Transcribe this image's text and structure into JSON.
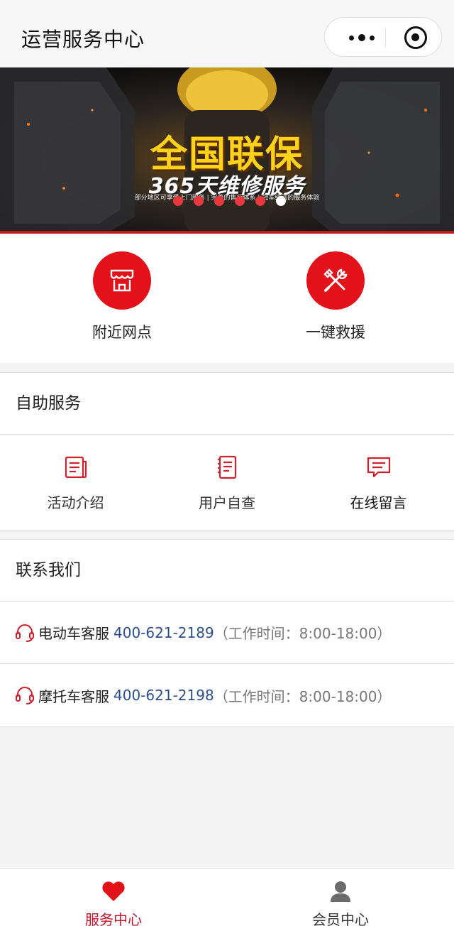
{
  "navbar": {
    "title": "运营服务中心",
    "more_icon": "more-dots-icon",
    "close_icon": "target-icon"
  },
  "banner": {
    "headline": "全国联保",
    "subline": "365天维修服务",
    "tagline": "部分地区可享受上门服务 | 完善的售后体系 | 冠军级别的服务体验",
    "slide_count": 6,
    "active_slide": 6,
    "colors": {
      "headline": "#ffd21a",
      "accent": "#c21818",
      "dot": "#e8383d"
    }
  },
  "quick_actions": [
    {
      "label": "附近网点",
      "icon": "store-icon"
    },
    {
      "label": "一键救援",
      "icon": "tools-icon"
    }
  ],
  "self_service": {
    "title": "自助服务",
    "items": [
      {
        "label": "活动介绍",
        "icon": "document-icon"
      },
      {
        "label": "用户自查",
        "icon": "checklist-icon"
      },
      {
        "label": "在线留言",
        "icon": "message-icon"
      }
    ]
  },
  "contact": {
    "title": "联系我们",
    "rows": [
      {
        "name": "电动车客服",
        "phone": "400-621-2189",
        "hours": "（工作时间：8:00-18:00）",
        "icon": "headset-icon"
      },
      {
        "name": "摩托车客服",
        "phone": "400-621-2198",
        "hours": "（工作时间：8:00-18:00）",
        "icon": "headset-icon"
      }
    ]
  },
  "tabbar": {
    "items": [
      {
        "label": "服务中心",
        "icon": "heart-icon",
        "active": true
      },
      {
        "label": "会员中心",
        "icon": "user-icon",
        "active": false
      }
    ],
    "colors": {
      "active": "#c0152a",
      "primary": "#e3111a"
    }
  }
}
